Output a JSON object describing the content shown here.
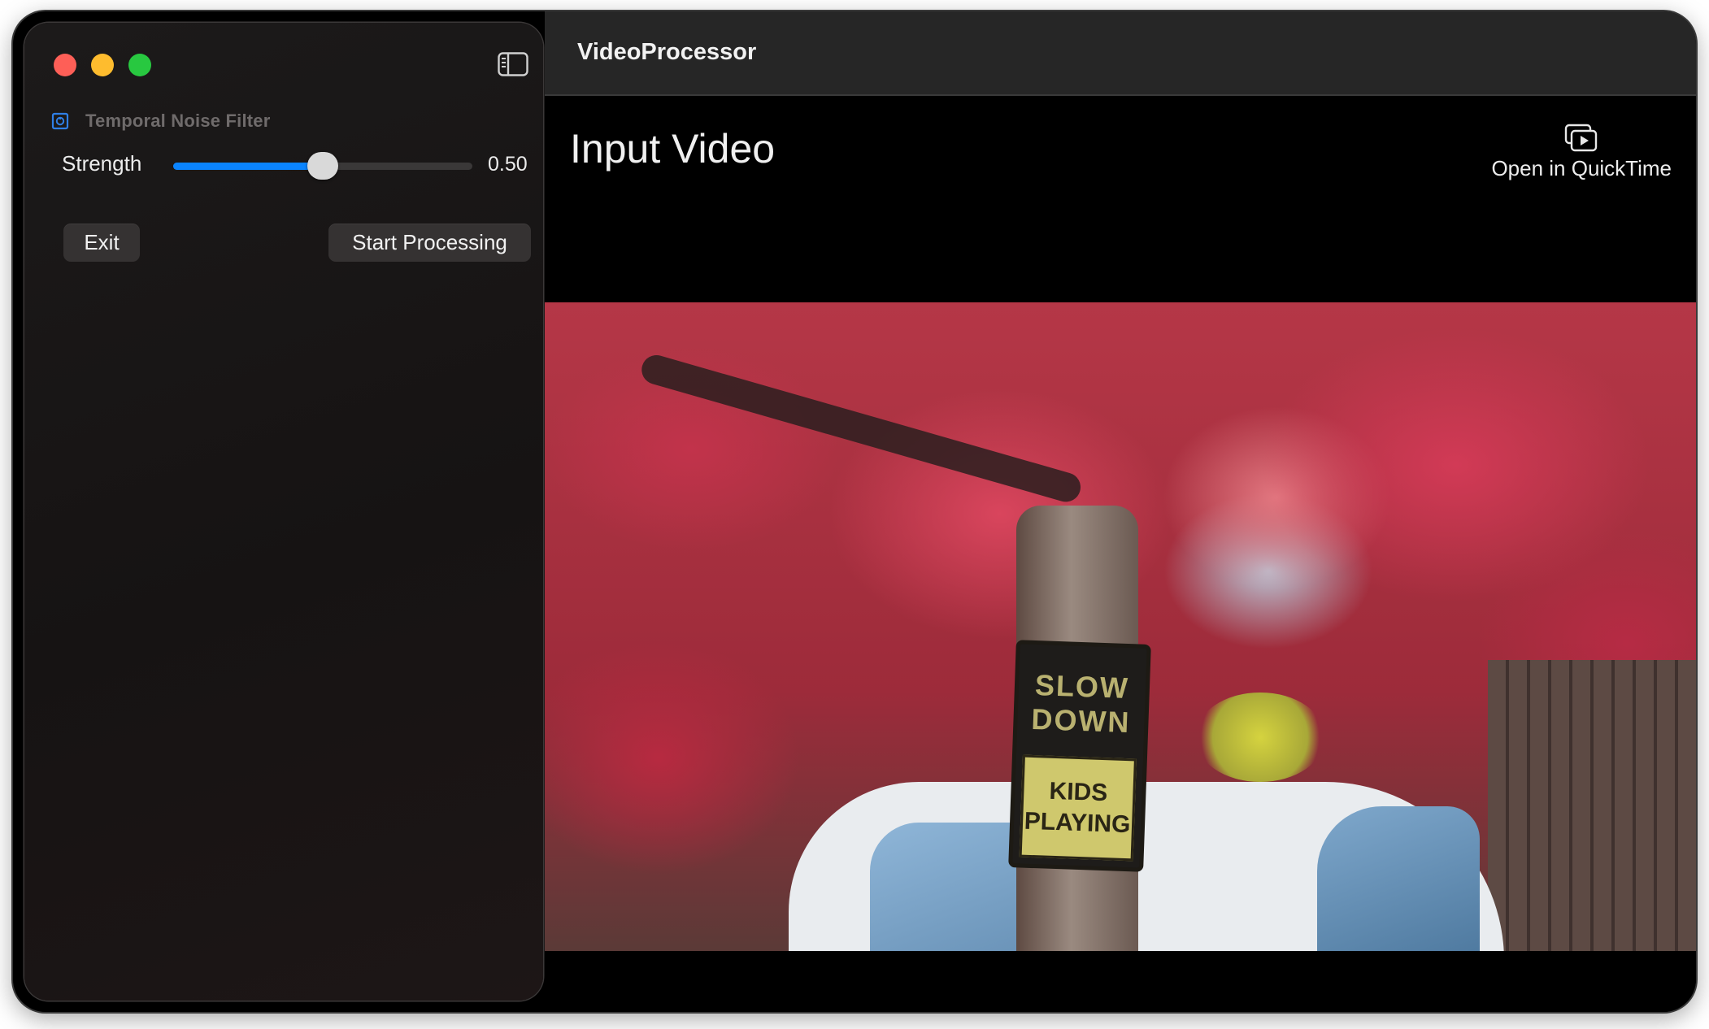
{
  "window": {
    "app_title": "VideoProcessor"
  },
  "sidebar": {
    "section_title": "Temporal Noise Filter",
    "section_icon": "filter-icon",
    "strength_label": "Strength",
    "strength_value": "0.50",
    "strength_fraction": 0.5,
    "exit_label": "Exit",
    "start_label": "Start Processing"
  },
  "main": {
    "heading": "Input Video",
    "open_quicktime_label": "Open in QuickTime",
    "open_quicktime_icon": "play-window-icon",
    "video": {
      "sign_top_line1": "SLOW",
      "sign_top_line2": "DOWN",
      "sign_bottom_line1": "KIDS",
      "sign_bottom_line2": "PLAYING"
    }
  },
  "colors": {
    "accent": "#0a84ff",
    "close": "#fe5f57",
    "minimize": "#febc2e",
    "maximize": "#28c840"
  }
}
